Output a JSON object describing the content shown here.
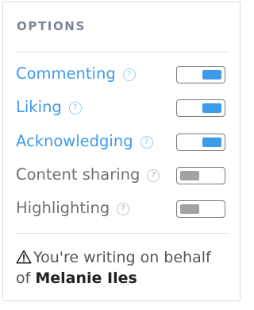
{
  "options": {
    "title": "OPTIONS",
    "help_glyph": "?",
    "items": [
      {
        "label": "Commenting",
        "enabled": true
      },
      {
        "label": "Liking",
        "enabled": true
      },
      {
        "label": "Acknowledging",
        "enabled": true
      },
      {
        "label": "Content sharing",
        "enabled": false
      },
      {
        "label": "Highlighting",
        "enabled": false
      }
    ]
  },
  "notice": {
    "icon": "warning-icon",
    "text_prefix": "You're writing on behalf of",
    "person_name": "Melanie Iles"
  },
  "colors": {
    "accent": "#3d9be9",
    "disabled": "#a2a2a2",
    "title": "#7a8696"
  }
}
